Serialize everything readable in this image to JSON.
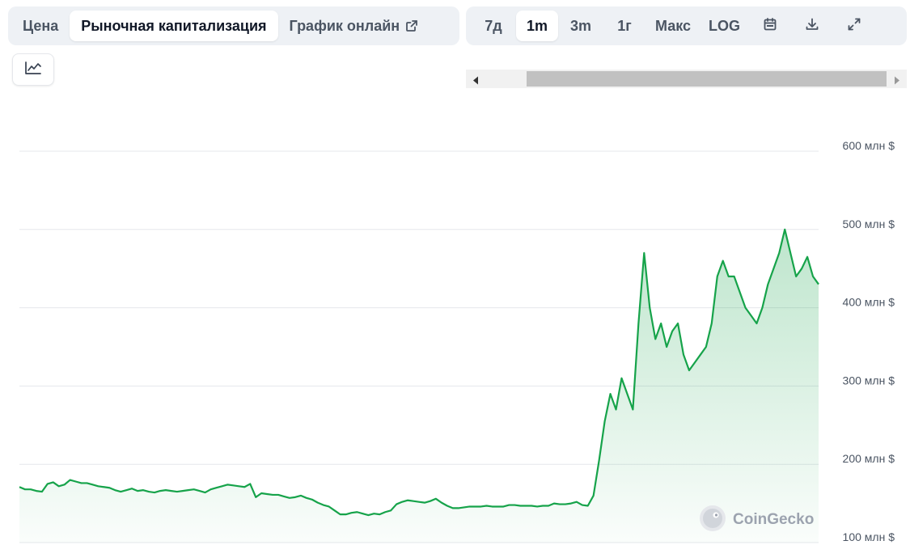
{
  "tabs": [
    {
      "label": "Цена",
      "active": false
    },
    {
      "label": "Рыночная капитализация",
      "active": true
    },
    {
      "label": "График онлайн",
      "active": false,
      "external": true
    }
  ],
  "ranges": [
    {
      "label": "7д",
      "active": false
    },
    {
      "label": "1m",
      "active": true
    },
    {
      "label": "3m",
      "active": false
    },
    {
      "label": "1г",
      "active": false
    },
    {
      "label": "Макс",
      "active": false
    },
    {
      "label": "LOG",
      "active": false
    }
  ],
  "icons": {
    "calendar": "calendar-icon",
    "download": "download-icon",
    "expand": "expand-icon",
    "line_chart": "line-chart-icon"
  },
  "watermark": "CoinGecko",
  "colors": {
    "line": "#16a34a",
    "area_top": "#16a34a",
    "grid": "#e5e7eb"
  },
  "chart_data": {
    "type": "area",
    "title": "",
    "xlabel": "",
    "ylabel": "",
    "y_axis_position": "right",
    "grid": true,
    "ylim": [
      100,
      600
    ],
    "yticks": [
      100,
      200,
      300,
      400,
      500,
      600
    ],
    "ytick_labels": [
      "100 млн $",
      "200 млн $",
      "300 млн $",
      "400 млн $",
      "500 млн $",
      "600 млн $"
    ],
    "series": [
      {
        "values": [
          171,
          168,
          168,
          166,
          165,
          175,
          177,
          172,
          174,
          180,
          178,
          176,
          176,
          174,
          172,
          171,
          170,
          167,
          165,
          167,
          169,
          166,
          167,
          165,
          164,
          166,
          167,
          166,
          165,
          166,
          167,
          168,
          166,
          164,
          168,
          170,
          172,
          174,
          173,
          172,
          171,
          175,
          158,
          163,
          162,
          161,
          161,
          159,
          157,
          158,
          160,
          157,
          155,
          151,
          148,
          146,
          141,
          136,
          136,
          138,
          139,
          137,
          135,
          137,
          136,
          139,
          141,
          149,
          152,
          154,
          153,
          152,
          151,
          153,
          156,
          151,
          147,
          144,
          144,
          145,
          146,
          146,
          146,
          147,
          146,
          146,
          146,
          148,
          148,
          147,
          147,
          147,
          146,
          147,
          147,
          150,
          149,
          149,
          150,
          152,
          148,
          147,
          160,
          205,
          255,
          290,
          270,
          310,
          290,
          270,
          380,
          470,
          400,
          360,
          380,
          350,
          370,
          380,
          340,
          320,
          330,
          340,
          350,
          380,
          440,
          460,
          440,
          440,
          420,
          400,
          390,
          380,
          400,
          430,
          450,
          470,
          500,
          470,
          440,
          450,
          465,
          440,
          430
        ]
      }
    ]
  }
}
